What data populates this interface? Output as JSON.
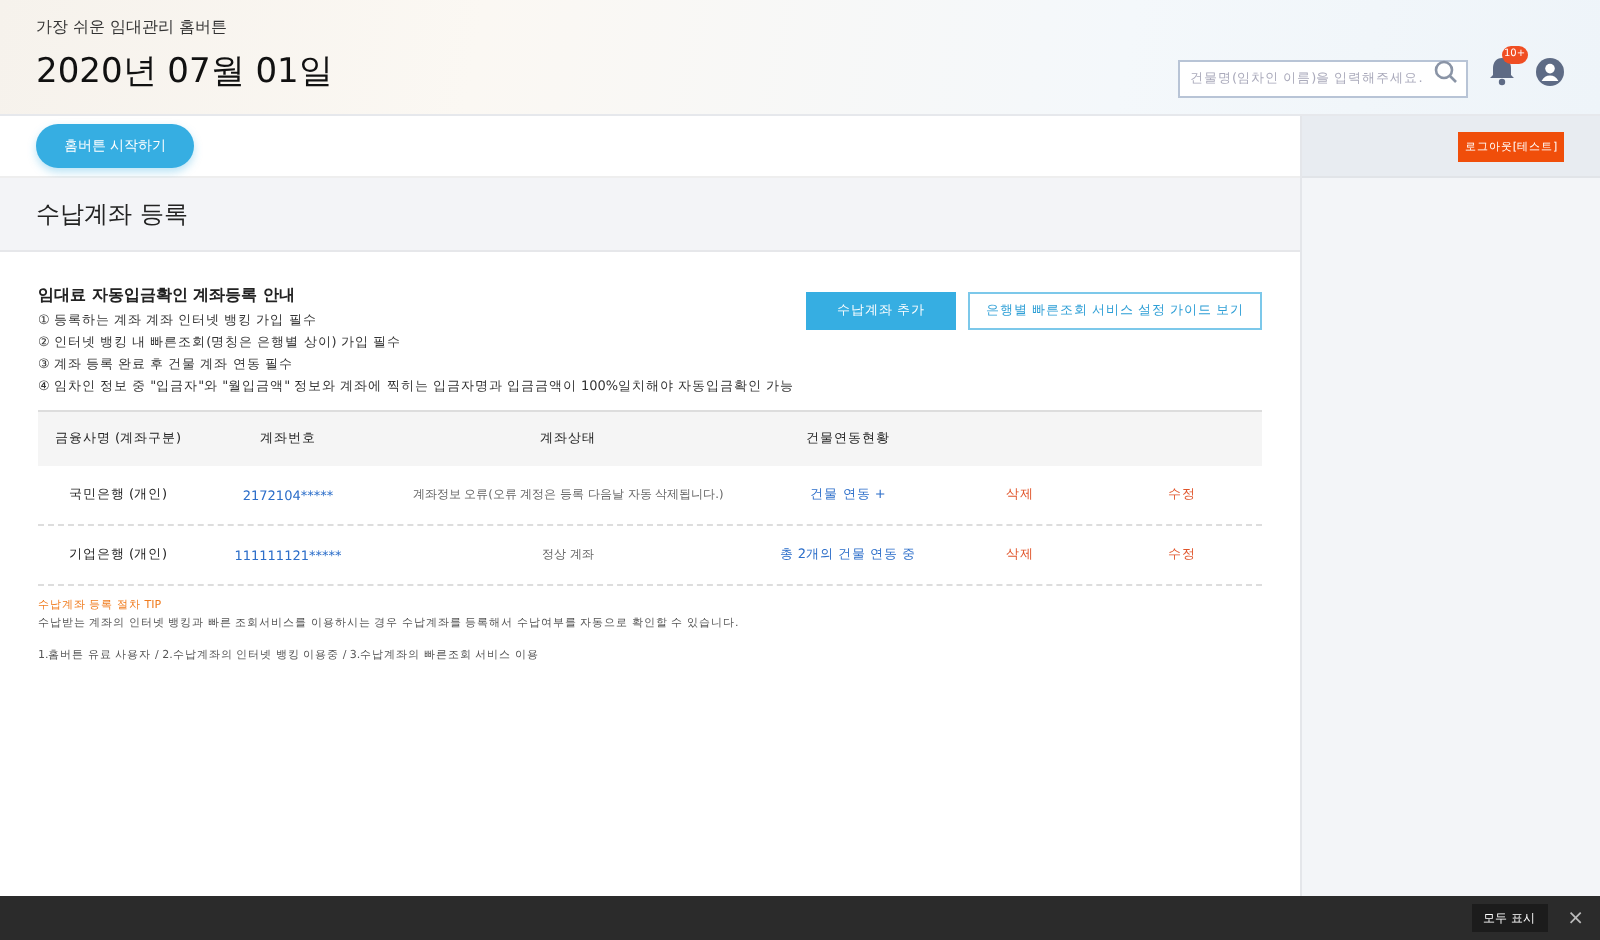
{
  "header": {
    "tagline": "가장 쉬운 임대관리 홈버튼",
    "date": "2020년 07월 01일",
    "search": {
      "placeholder": "건물명(임차인 이름)을 입력해주세요."
    },
    "notification_badge": "10+"
  },
  "nav": {
    "start_button": "홈버튼 시작하기",
    "logout_button": "로그아웃[테스트]"
  },
  "page_title": "수납계좌 등록",
  "guide": {
    "title": "임대료 자동입금확인 계좌등록 안내",
    "items": [
      "① 등록하는 계좌 계좌 인터넷 뱅킹 가입 필수",
      "② 인터넷 뱅킹 내 빠른조회(명칭은 은행별 상이) 가입 필수",
      "③ 계좌 등록 완료 후 건물 계좌 연동 필수",
      "④ 임차인 정보 중 \"입금자\"와 \"월입금액\" 정보와 계좌에 찍히는 입금자명과 입금금액이 100%일치해야 자동입금확인 가능"
    ]
  },
  "actions": [
    "수납계좌 추가",
    "은행별 빠른조회 서비스 설정 가이드 보기"
  ],
  "table": {
    "columns": [
      "금융사명 (계좌구분)",
      "계좌번호",
      "계좌상태",
      "건물연동현황"
    ],
    "rows": [
      {
        "bank": "국민은행 (개인)",
        "account": "2172104*****",
        "status": "계좌정보 오류(오류 계정은 등록 다음날 자동 삭제됩니다.)",
        "link": "건물 연동 +",
        "delete": "삭제",
        "edit": "수정"
      },
      {
        "bank": "기업은행 (개인)",
        "account": "111111121*****",
        "status": "정상 계좌",
        "link": "총 2개의 건물 연동 중",
        "delete": "삭제",
        "edit": "수정"
      }
    ]
  },
  "tip": {
    "title": "수납계좌 등록 절차 TIP",
    "text": "수납받는 계좌의 인터넷 뱅킹과 빠른 조회서비스를 이용하시는 경우 수납계좌를 등록해서 수납여부를 자동으로 확인할 수 있습니다.",
    "steps": "1.홈버튼 유료 사용자 / 2.수납계좌의 인터넷 뱅킹 이용중 / 3.수납계좌의 빠른조회 서비스 이용"
  },
  "bottom_bar": {
    "show_all": "모두 표시",
    "close": "×"
  }
}
